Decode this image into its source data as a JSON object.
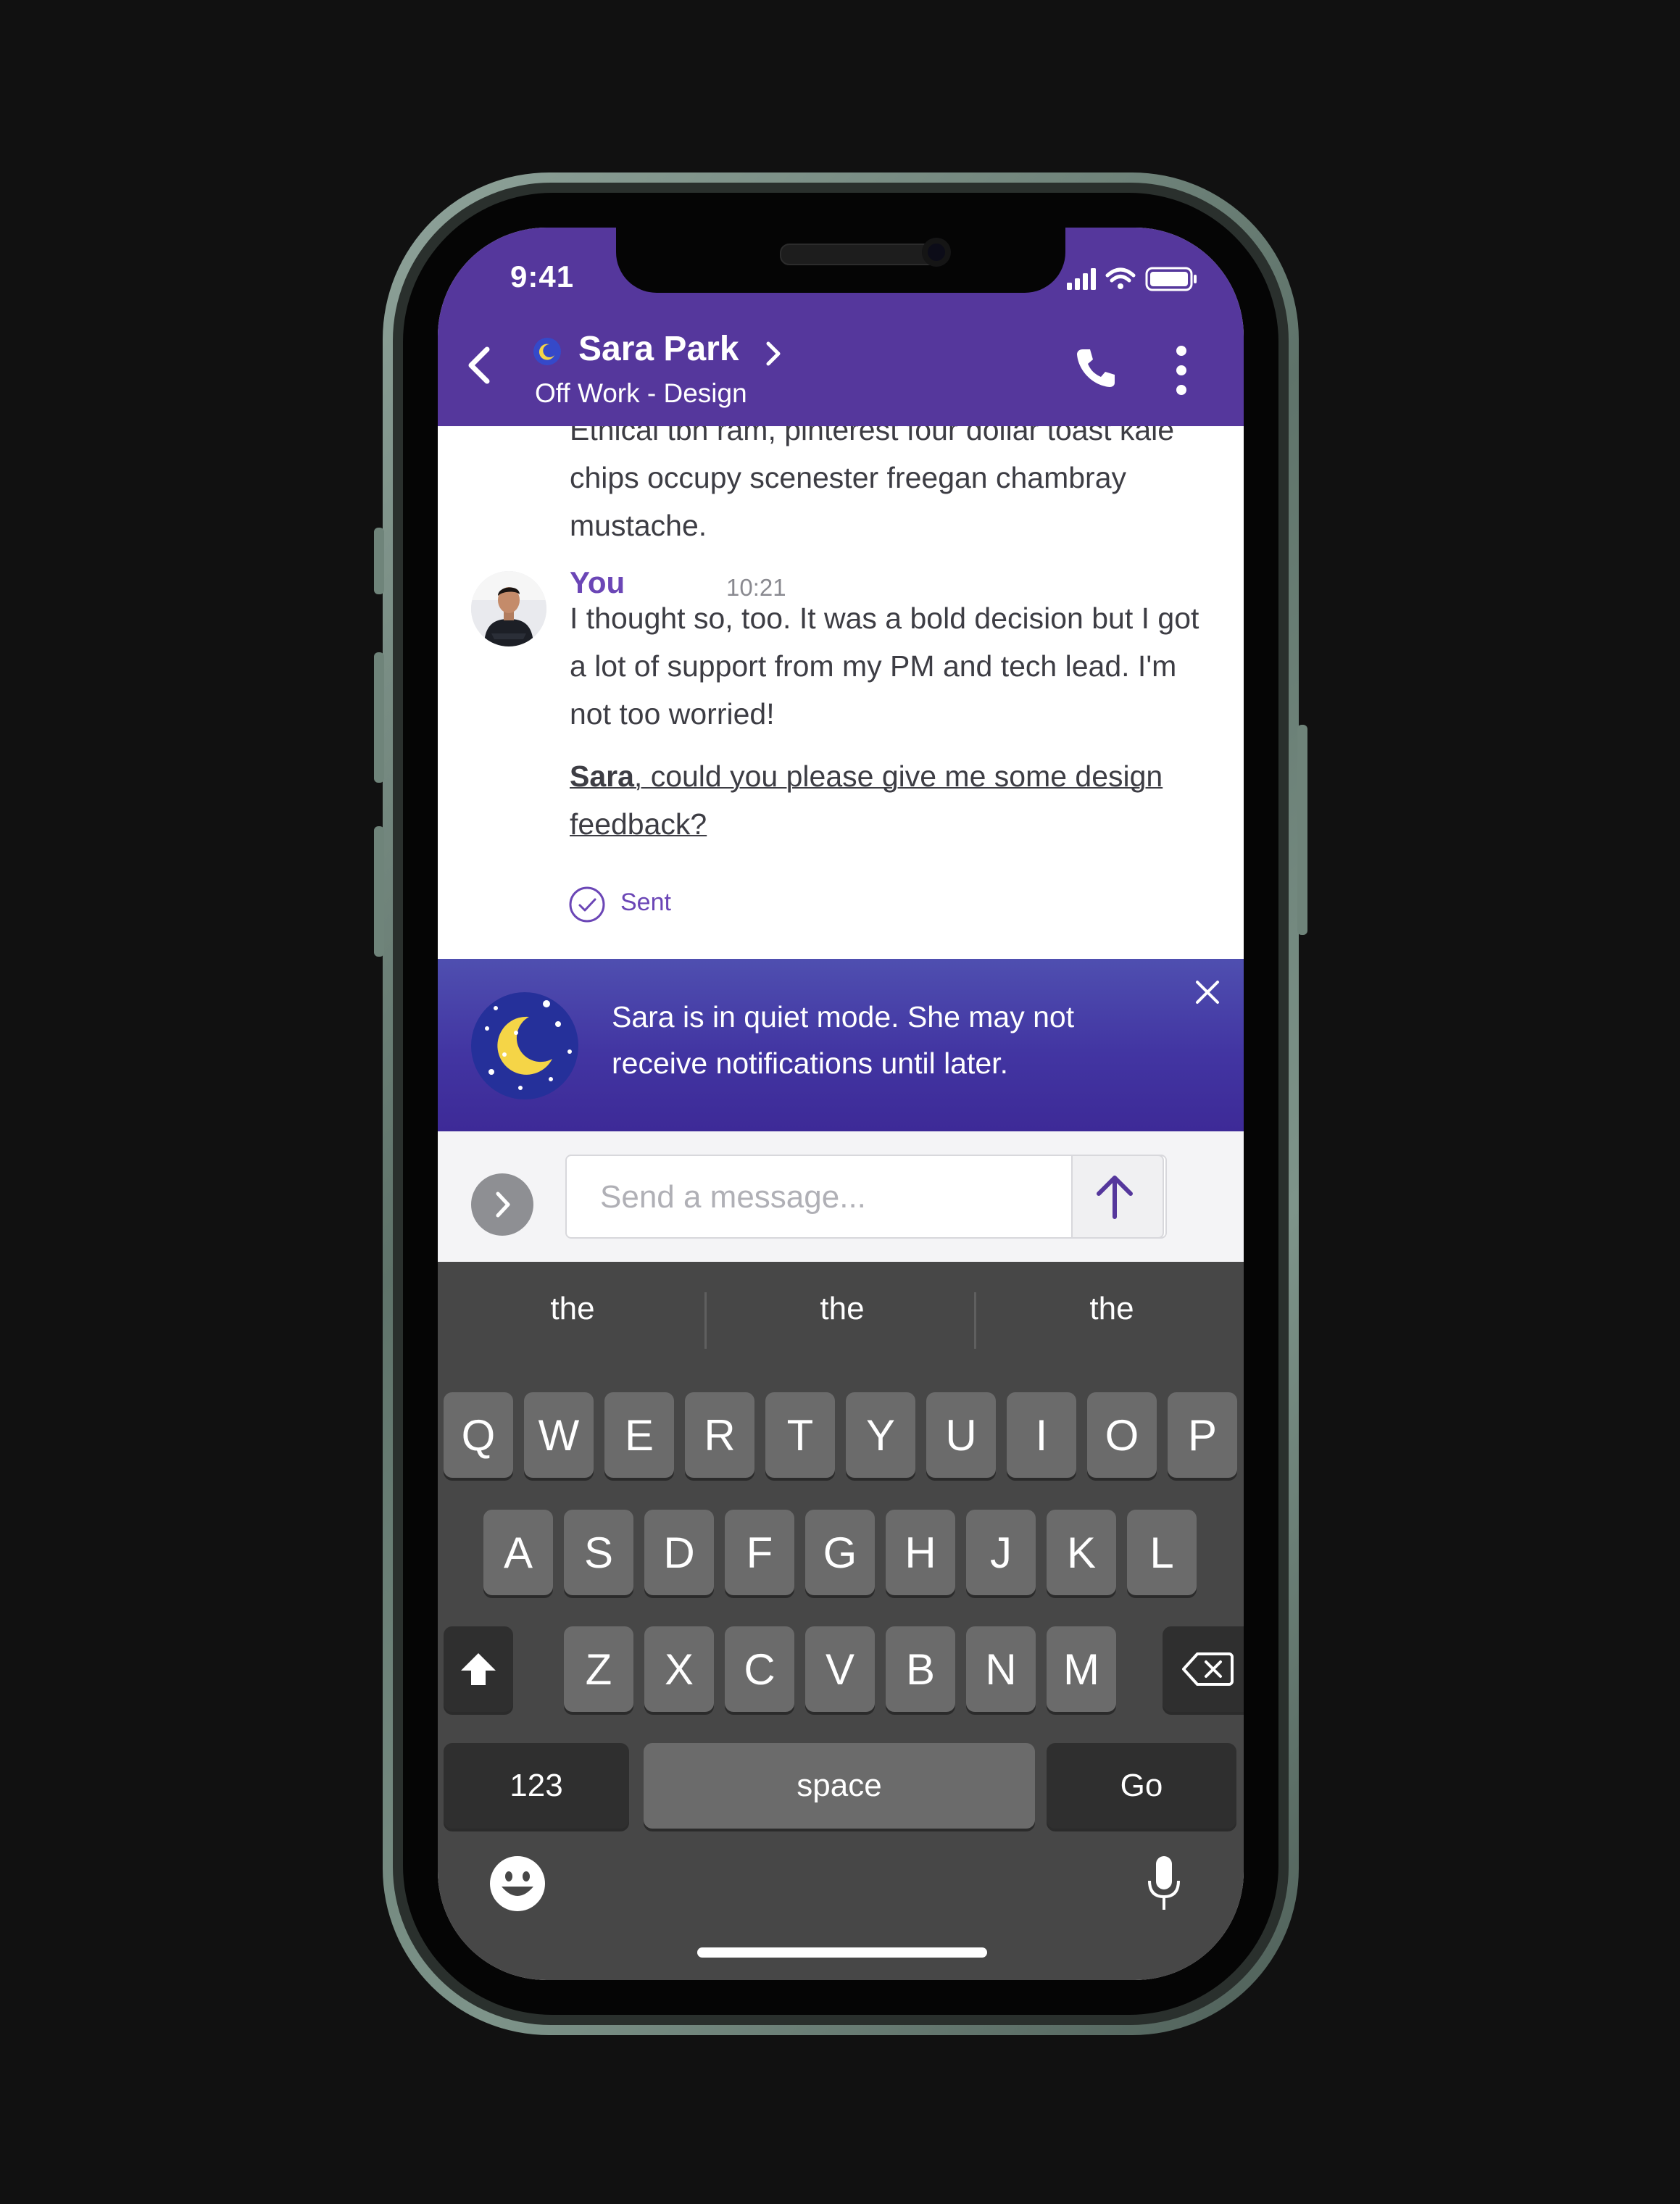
{
  "status_bar": {
    "time": "9:41"
  },
  "header": {
    "contact_name": "Sara Park",
    "contact_status": "Off Work - Design"
  },
  "messages": {
    "previous_text": "Ethical tbh ram, pinterest four dollar toast kale chips occupy scenester freegan chambray mustache.",
    "sender": "You",
    "time": "10:21",
    "body": "I thought so, too. It was a bold decision but I got a lot of support from my PM and tech lead. I'm not too worried!",
    "mention_name": "Sara",
    "mention_rest": ", could you please give me some design feedback?",
    "delivery_status": "Sent"
  },
  "quiet_mode_banner": {
    "text": "Sara is in quiet mode. She may not receive notifications until later."
  },
  "composer": {
    "placeholder": "Send a message..."
  },
  "keyboard": {
    "suggestions": [
      "the",
      "the",
      "the"
    ],
    "row1": [
      "Q",
      "W",
      "E",
      "R",
      "T",
      "Y",
      "U",
      "I",
      "O",
      "P"
    ],
    "row2": [
      "A",
      "S",
      "D",
      "F",
      "G",
      "H",
      "J",
      "K",
      "L"
    ],
    "row3": [
      "Z",
      "X",
      "C",
      "V",
      "B",
      "N",
      "M"
    ],
    "numbers_key": "123",
    "space_key": "space",
    "go_key": "Go"
  },
  "colors": {
    "accent": "#55379c",
    "banner": "#4235a2",
    "moon": "#f5d547",
    "keyboard_bg": "#474747"
  },
  "icons": [
    "back-arrow-icon",
    "moon-icon",
    "chevron-right-icon",
    "phone-icon",
    "more-vertical-icon",
    "check-circle-icon",
    "close-icon",
    "chevron-right-icon",
    "arrow-up-icon",
    "shift-icon",
    "backspace-icon",
    "emoji-icon",
    "microphone-icon"
  ]
}
